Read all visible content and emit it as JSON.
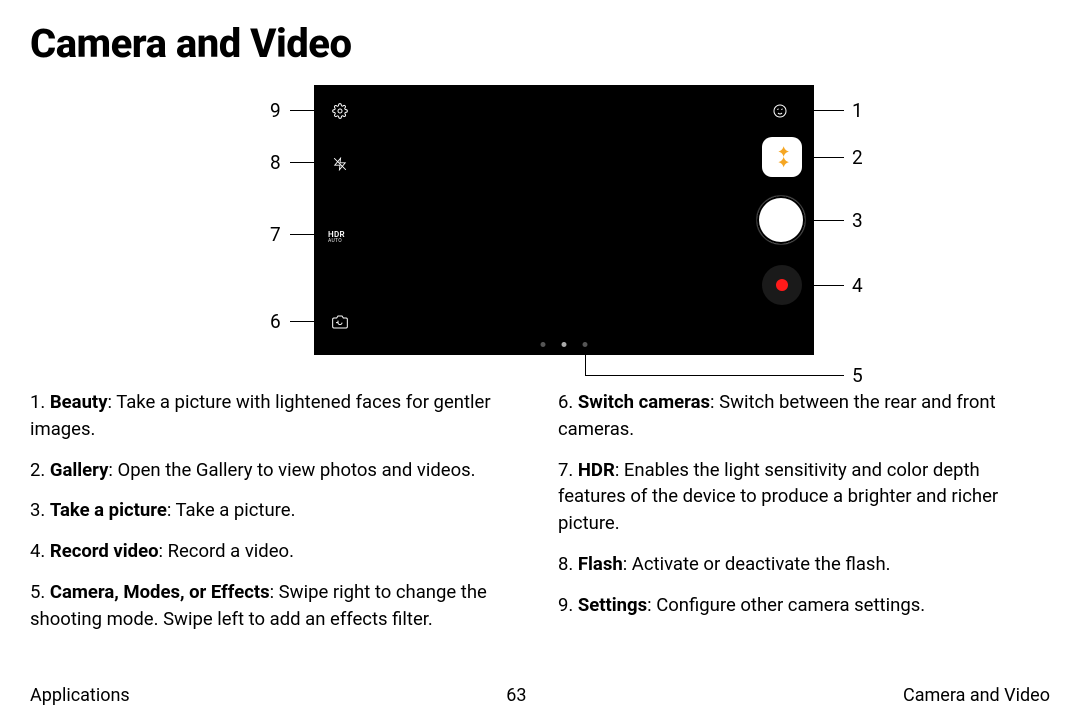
{
  "title": "Camera and Video",
  "callouts": {
    "n1": "1",
    "n2": "2",
    "n3": "3",
    "n4": "4",
    "n5": "5",
    "n6": "6",
    "n7": "7",
    "n8": "8",
    "n9": "9"
  },
  "hdr": {
    "main": "HDR",
    "sub": "AUTO"
  },
  "left_list": [
    {
      "num": "1.",
      "term": "Beauty",
      "text": ": Take a picture with lightened faces for gentler images."
    },
    {
      "num": "2.",
      "term": "Gallery",
      "text": ": Open the Gallery to view photos and videos."
    },
    {
      "num": "3.",
      "term": "Take a picture",
      "text": ": Take a picture."
    },
    {
      "num": "4.",
      "term": "Record video",
      "text": ": Record a video."
    },
    {
      "num": "5.",
      "term": "Camera, Modes, or Effects",
      "text": ": Swipe right to change the shooting mode. Swipe left to add an effects filter."
    }
  ],
  "right_list": [
    {
      "num": "6.",
      "term": "Switch cameras",
      "text": ": Switch between the rear and front cameras."
    },
    {
      "num": "7.",
      "term": "HDR",
      "text": ": Enables the light sensitivity and color depth features of the device to produce a brighter and richer picture."
    },
    {
      "num": "8.",
      "term": "Flash",
      "text": ": Activate or deactivate the flash."
    },
    {
      "num": "9.",
      "term": "Settings",
      "text": ": Configure other camera settings."
    }
  ],
  "footer": {
    "left": "Applications",
    "center": "63",
    "right": "Camera and Video"
  }
}
